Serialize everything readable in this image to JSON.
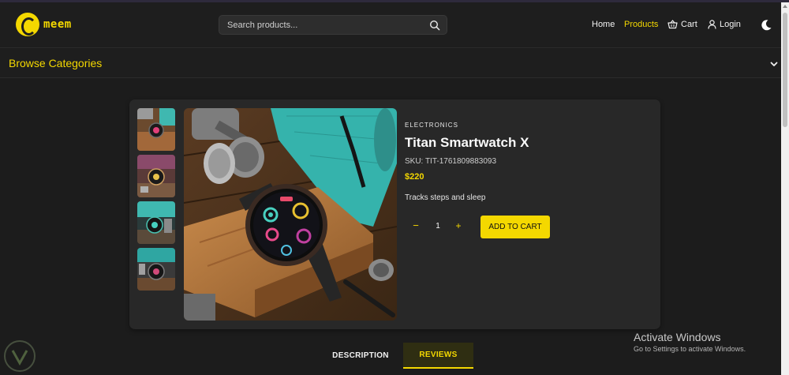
{
  "header": {
    "logo_text": "meem",
    "search_placeholder": "Search products...",
    "nav": {
      "home": "Home",
      "products": "Products",
      "cart": "Cart",
      "login": "Login"
    },
    "active_nav": "Products"
  },
  "categories": {
    "title": "Browse Categories"
  },
  "product": {
    "category": "ELECTRONICS",
    "name": "Titan Smartwatch X",
    "sku": "SKU: TIT-1761809883093",
    "price": "$220",
    "description": "Tracks steps and sleep",
    "quantity": "1",
    "decrement_label": "−",
    "increment_label": "+",
    "add_to_cart_label": "ADD TO CART",
    "thumbnail_count": 4
  },
  "tabs": {
    "description": "DESCRIPTION",
    "reviews": "REVIEWS",
    "active": "REVIEWS"
  },
  "windows_watermark": {
    "title": "Activate Windows",
    "subtitle": "Go to Settings to activate Windows."
  },
  "colors": {
    "accent": "#f4d800",
    "background": "#1c1c1c",
    "card": "#282828"
  },
  "icons": {
    "search": "search-icon",
    "cart": "cart-icon",
    "user": "user-icon",
    "theme": "moon-icon",
    "chevron": "chevron-down-icon"
  }
}
